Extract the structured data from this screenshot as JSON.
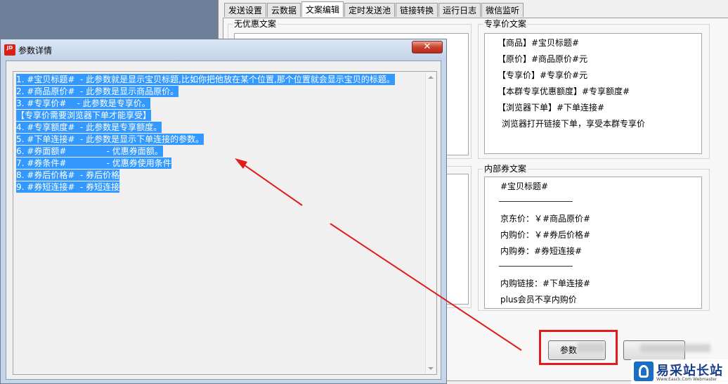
{
  "bg_window": {
    "tabs": [
      "发送设置",
      "云数据",
      "文案编辑",
      "定时发送池",
      "链接转换",
      "运行日志",
      "微信监听"
    ],
    "active_tab_index": 2,
    "no_coupon": {
      "title": "无优惠文案"
    },
    "exclusive": {
      "title": "专享价文案",
      "lines": [
        "【商品】#宝贝标题#",
        "【原价】#商品原价#元",
        "【专享价】#专享价#元",
        "【本群专享优惠额度】#专享额度#",
        "【浏览器下单】#下单连接#",
        "浏览器打开链接下单，享受本群专享价"
      ]
    },
    "internal": {
      "title": "内部券文案",
      "lines": [
        "#宝贝标题#",
        "京东价：￥#商品原价#",
        "内购价：￥#券后价格#",
        "内购券：#券短连接#",
        "内购链接：#下单连接#",
        "plus会员不享内购价"
      ]
    },
    "buttons": {
      "params": "参数",
      "second": ""
    }
  },
  "dialog": {
    "title": "参数详情",
    "icon_text": "JD",
    "close_label": "✕",
    "lines": [
      "1. #宝贝标题#  - 此参数就是显示宝贝标题,比如你把他放在某个位置,那个位置就会显示宝贝的标题。",
      "2. #商品原价#  - 此参数是显示商品原价。",
      "3. #专享价#    - 此参数是专享价。",
      "【专享价需要浏览器下单才能享受】",
      "4. #专享额度#  - 此参数是专享额度。",
      "5. #下单连接#  - 此参数是显示下单连接的参数。",
      "6. #券面额#               - 优惠券面额。",
      "7. #券条件#               - 优惠券使用条件",
      "8. #券后价格#  - 券后价格",
      "9. #券短连接#  - 券短连接"
    ]
  },
  "watermark": {
    "text": "易采站长站",
    "sub": "Www.Easck.Com Webmaster"
  },
  "colors": {
    "selection": "#3399ff",
    "annotation_red": "#e21b1b",
    "desktop": "#6d7f99"
  }
}
